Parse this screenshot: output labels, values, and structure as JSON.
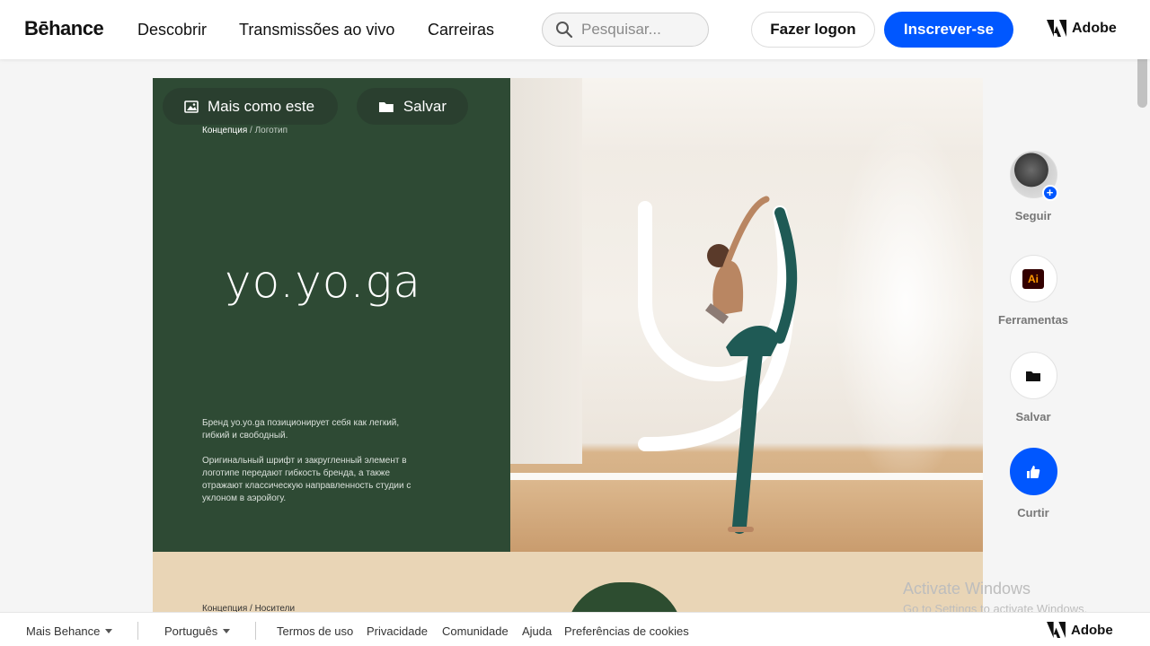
{
  "header": {
    "logo": "Bēhance",
    "nav": [
      "Descobrir",
      "Transmissões ao vivo",
      "Carreiras"
    ],
    "search_placeholder": "Pesquisar...",
    "login_label": "Fazer logon",
    "signup_label": "Inscrever-se",
    "adobe_label": "Adobe"
  },
  "project": {
    "more_like_this": "Mais como este",
    "save": "Salvar",
    "breadcrumb": {
      "first": "Концепция",
      "sep": "/",
      "second": "Логотип"
    },
    "brand_word": "yo.yo.ga",
    "desc_1": "Бренд yo.yo.ga позиционирует себя как легкий, гибкий и свободный.",
    "desc_2": "Оригинальный шрифт и закругленный элемент в логотипе передают гибкость бренда, а также отражают классическую направленность студии с уклоном в аэройогу.",
    "breadcrumb2": {
      "first": "Концепция",
      "sep": "/",
      "second": "Носители"
    }
  },
  "rail": {
    "follow": "Seguir",
    "tools": "Ferramentas",
    "tools_icon_text": "Ai",
    "save": "Salvar",
    "like": "Curtir"
  },
  "activate": {
    "title": "Activate Windows",
    "subtitle": "Go to Settings to activate Windows."
  },
  "footer": {
    "more": "Mais Behance",
    "language": "Português",
    "links": [
      "Termos de uso",
      "Privacidade",
      "Comunidade",
      "Ajuda",
      "Preferências de cookies"
    ],
    "adobe_label": "Adobe"
  },
  "colors": {
    "accent": "#0057ff",
    "panel_green": "#2e4a34",
    "beige_band": "#e9d5b6"
  }
}
